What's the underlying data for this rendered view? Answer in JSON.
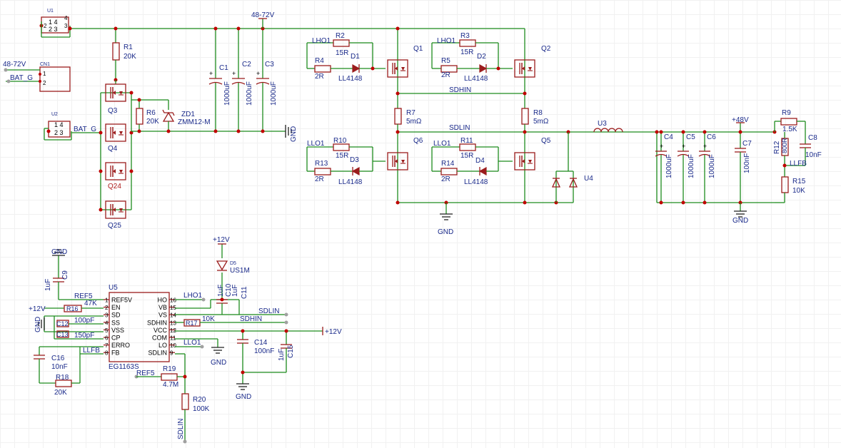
{
  "supply": {
    "top": "48-72V",
    "p12_a": "+12V",
    "p12_b": "+12V",
    "p12_c": "+12V",
    "p48": "+48V"
  },
  "connectors": {
    "u1": "U1",
    "u2": "U2",
    "cn1": "CN1",
    "u1_pins_top": "1 4",
    "u1_pins_bot": "2 3",
    "u2_pins_top": "1 4",
    "u2_pins_bot": "2 3",
    "cn1_p1": "1",
    "cn1_p2": "2",
    "cn1_net": "48-72V",
    "cn1_bat": "BAT_G",
    "u2_bat": "BAT_G"
  },
  "parts": {
    "r1": "R1",
    "r1v": "20K",
    "r6": "R6",
    "r6v": "20K",
    "zd1": "ZD1",
    "zd1v": "ZMM12-M",
    "q3": "Q3",
    "q4": "Q4",
    "q24": "Q24",
    "q25": "Q25",
    "c1": "C1",
    "c2": "C2",
    "c3": "C3",
    "c1v": "1000uF",
    "c2v": "1000uF",
    "c3v": "1000uF",
    "r2": "R2",
    "r2v": "15R",
    "r4": "R4",
    "r4v": "2R",
    "d1": "D1",
    "d1v": "LL4148",
    "q1": "Q1",
    "r3": "R3",
    "r3v": "15R",
    "r5": "R5",
    "r5v": "2R",
    "d2": "D2",
    "d2v": "LL4148",
    "q2": "Q2",
    "r7": "R7",
    "r7v": "5mΩ",
    "r8": "R8",
    "r8v": "5mΩ",
    "r10": "R10",
    "r10v": "15R",
    "r13": "R13",
    "r13v": "2R",
    "d3": "D3",
    "d3v": "LL4148",
    "q6": "Q6",
    "r11": "R11",
    "r11v": "15R",
    "r14": "R14",
    "r14v": "2R",
    "d4": "D4",
    "d4v": "LL4148",
    "q5": "Q5",
    "u3": "U3",
    "u4": "U4",
    "c4": "C4",
    "c5": "C5",
    "c6": "C6",
    "c7": "C7",
    "c4v": "1000uF",
    "c5v": "1000uF",
    "c6v": "1000uF",
    "c7v": "100nF",
    "r9": "R9",
    "r9v": "1.5K",
    "r12": "R12",
    "r12v": "800R",
    "r15": "R15",
    "r15v": "10K",
    "c8": "C8",
    "c8v": "10nF",
    "u5": "U5",
    "u5v": "EG1163S",
    "c9": "C9",
    "c9v": "1uF",
    "r16": "R16",
    "c12": "C12",
    "c12v": "100pF",
    "c13": "C13",
    "c13v": "150pF",
    "c16": "C16",
    "c16v": "10nF",
    "r18": "R18",
    "r18v": "20K",
    "d5": "D5",
    "d5v": "US1M",
    "c10": "C10",
    "c10v": "1uF",
    "c11": "C11",
    "c11v": "1uF",
    "r17": "R17",
    "r17v": "10K",
    "c14": "C14",
    "c14v": "100nF",
    "c15": "C15",
    "c15v": "1uF",
    "r19": "R19",
    "r19v": "4.7M",
    "r20": "R20",
    "r20v": "100K"
  },
  "nets": {
    "gnd1": "GND",
    "gnd2": "GND",
    "gnd3": "GND",
    "gnd4": "GND",
    "gnd5": "GND",
    "gnd6": "GND",
    "gnd7": "GND",
    "lho1": "LHO1",
    "lho1b": "LHO1",
    "llo1": "LLO1",
    "llo1b": "LLO1",
    "sdhin": "SDHIN",
    "sdlin": "SDLIN",
    "ref5a": "REF5",
    "ref5b": "REF5",
    "r16v": "47K",
    "llfb_a": "LLFB",
    "llfb_b": "LLFB",
    "u5_lho1": "LHO1",
    "u5_llo1": "LLO1",
    "u5_sdlin": "SDLIN",
    "u5_sdhin": "SDHIN",
    "u5_sdlin_b": "SDLIN"
  },
  "u5_pins_left": [
    {
      "n": "1",
      "name": "REF5V"
    },
    {
      "n": "2",
      "name": "EN"
    },
    {
      "n": "3",
      "name": "SD"
    },
    {
      "n": "4",
      "name": "SS"
    },
    {
      "n": "5",
      "name": "VSS"
    },
    {
      "n": "6",
      "name": "CP"
    },
    {
      "n": "7",
      "name": "ERRO"
    },
    {
      "n": "8",
      "name": "FB"
    }
  ],
  "u5_pins_right": [
    {
      "n": "16",
      "name": "HO"
    },
    {
      "n": "15",
      "name": "VB"
    },
    {
      "n": "14",
      "name": "VS"
    },
    {
      "n": "13",
      "name": "SDHIN"
    },
    {
      "n": "12",
      "name": "VCC"
    },
    {
      "n": "11",
      "name": "COM"
    },
    {
      "n": "10",
      "name": "LO"
    },
    {
      "n": "9",
      "name": "SDLIN"
    }
  ],
  "colors": {
    "wire": "#1e8c1e",
    "part": "#9b1c1c",
    "label": "#1a2a8a",
    "junction": "#c00000",
    "grid": "#f1f1f1"
  }
}
